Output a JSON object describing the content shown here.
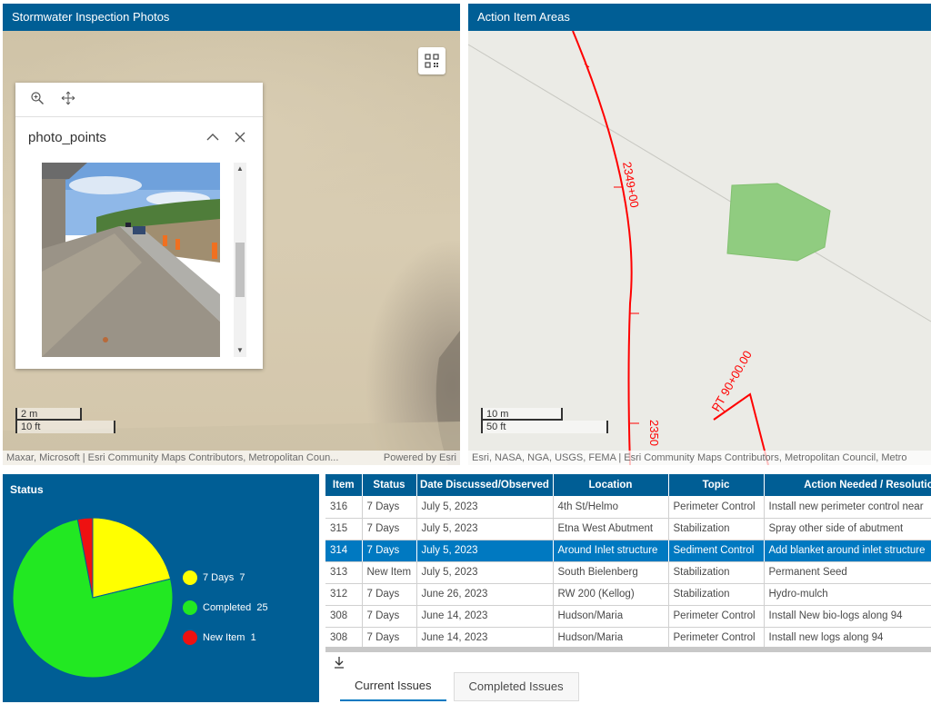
{
  "panels": {
    "photos_title": "Stormwater Inspection Photos",
    "action_title": "Action Item Areas",
    "status_title": "Status"
  },
  "popup": {
    "title": "photo_points"
  },
  "map_left": {
    "scale_metric": "2 m",
    "scale_imperial": "10 ft",
    "attribution": "Maxar, Microsoft | Esri Community Maps Contributors, Metropolitan Coun...",
    "powered_by": "Powered by Esri"
  },
  "map_right": {
    "scale_metric": "10 m",
    "scale_imperial": "50 ft",
    "attribution": "Esri, NASA, NGA, USGS, FEMA | Esri Community Maps Contributors, Metropolitan Council, Metro",
    "station_label_1": "2349+00",
    "station_label_2": "2350",
    "pt_label": "PT 90+00.00",
    "colors": {
      "alignment": "#ff0000",
      "area_fill": "#90cc80"
    }
  },
  "chart_data": {
    "type": "pie",
    "categories": [
      "7 Days",
      "Completed",
      "New Item"
    ],
    "values": [
      7,
      25,
      1
    ],
    "colors": [
      "#ffff00",
      "#22e822",
      "#ee1111"
    ],
    "legend_position": "right"
  },
  "legend": [
    {
      "label": "7 Days",
      "value": "7"
    },
    {
      "label": "Completed",
      "value": "25"
    },
    {
      "label": "New Item",
      "value": "1"
    }
  ],
  "table": {
    "headers": [
      "Item",
      "Status",
      "Date Discussed/Observed",
      "Location",
      "Topic",
      "Action Needed / Resolution"
    ],
    "rows": [
      [
        "316",
        "7 Days",
        "July 5, 2023",
        "4th St/Helmo",
        "Perimeter Control",
        "Install new perimeter control near"
      ],
      [
        "315",
        "7 Days",
        "July 5, 2023",
        "Etna West Abutment",
        "Stabilization",
        "Spray other side of abutment"
      ],
      [
        "314",
        "7 Days",
        "July 5, 2023",
        "Around Inlet structure",
        "Sediment Control",
        "Add blanket around inlet structure"
      ],
      [
        "313",
        "New Item",
        "July 5, 2023",
        "South Bielenberg",
        "Stabilization",
        "Permanent Seed"
      ],
      [
        "312",
        "7 Days",
        "June 26, 2023",
        "RW 200 (Kellog)",
        "Stabilization",
        "Hydro-mulch"
      ],
      [
        "308",
        "7 Days",
        "June 14, 2023",
        "Hudson/Maria",
        "Perimeter Control",
        "Install New bio-logs along 94"
      ],
      [
        "308",
        "7 Days",
        "June 14, 2023",
        "Hudson/Maria",
        "Perimeter Control",
        "Install new logs along 94"
      ]
    ],
    "selected_row": 2
  },
  "tabs": [
    {
      "label": "Current Issues",
      "active": true
    },
    {
      "label": "Completed Issues",
      "active": false
    }
  ],
  "icons": {
    "zoom": "zoom-in-icon",
    "pan": "pan-icon",
    "collapse": "chevron-up-icon",
    "close": "close-icon",
    "qr": "qr-code-icon",
    "download": "download-icon"
  }
}
